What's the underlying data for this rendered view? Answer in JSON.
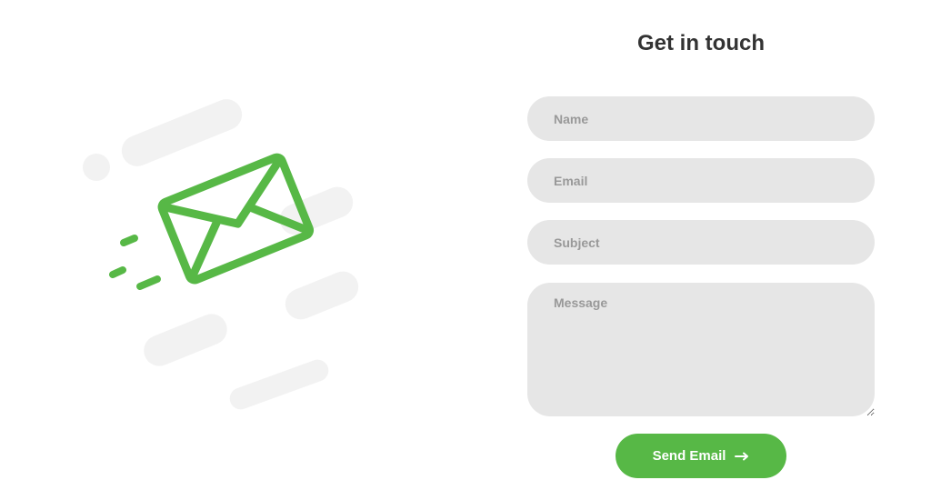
{
  "form": {
    "title": "Get in touch",
    "name_placeholder": "Name",
    "email_placeholder": "Email",
    "subject_placeholder": "Subject",
    "message_placeholder": "Message",
    "submit_label": "Send Email",
    "submit_icon": "arrow-right-icon"
  },
  "illustration": {
    "icon": "envelope-icon",
    "accent_color": "#57b846",
    "streak_color": "#f2f2f2"
  },
  "colors": {
    "field_background": "#e6e6e6",
    "title": "#333333",
    "placeholder": "#999999",
    "button": "#57b846"
  }
}
